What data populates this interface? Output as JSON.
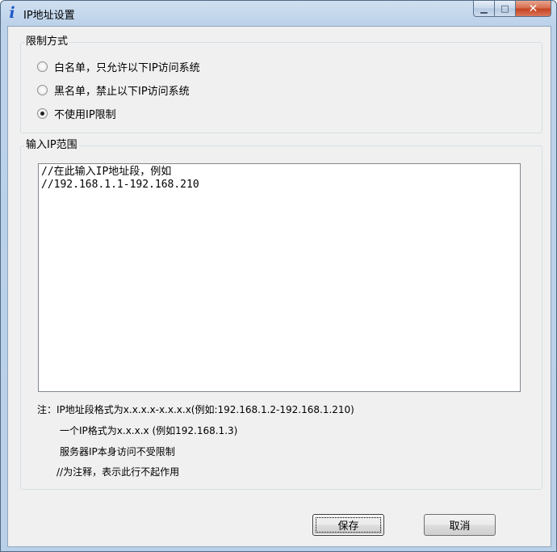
{
  "window": {
    "title": "IP地址设置",
    "app_icon_glyph": "i",
    "controls": {
      "minimize": "▁",
      "maximize": "□",
      "close": "✕"
    }
  },
  "restriction": {
    "title": "限制方式",
    "options": [
      {
        "label": "白名单，只允许以下IP访问系统",
        "checked": false
      },
      {
        "label": "黑名单，禁止以下IP访问系统",
        "checked": false
      },
      {
        "label": "不使用IP限制",
        "checked": true
      }
    ]
  },
  "ip_range": {
    "title": "输入IP范围",
    "text": "//在此输入IP地址段，例如\n//192.168.1.1-192.168.210"
  },
  "notes": {
    "line1": "注：IP地址段格式为x.x.x.x-x.x.x.x(例如:192.168.1.2-192.168.1.210)",
    "line2": "一个IP格式为x.x.x.x (例如192.168.1.3)",
    "line3": "服务器IP本身访问不受限制",
    "line4": "//为注释，表示此行不起作用"
  },
  "buttons": {
    "save": "保存",
    "cancel": "取消"
  }
}
